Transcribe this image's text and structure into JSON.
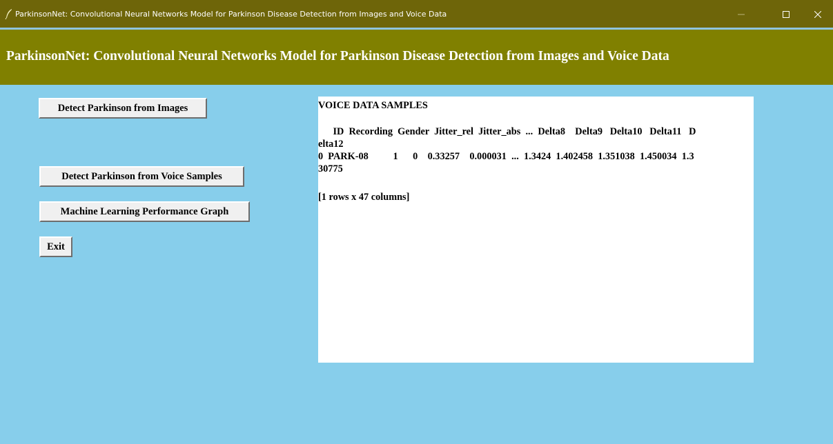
{
  "window": {
    "title": "ParkinsonNet: Convolutional Neural Networks Model for Parkinson Disease Detection from Images and Voice Data",
    "app_icon": "feather-icon",
    "controls": {
      "minimize": "minimize-icon",
      "maximize": "maximize-icon",
      "close": "close-icon"
    }
  },
  "header": {
    "title": "ParkinsonNet: Convolutional Neural Networks Model for Parkinson Disease Detection from Images and Voice Data"
  },
  "buttons": {
    "detect_images": "Detect Parkinson from Images",
    "detect_voice": "Detect Parkinson from Voice Samples",
    "ml_graph": "Machine Learning Performance Graph",
    "exit": "Exit"
  },
  "output": {
    "heading": "VOICE DATA SAMPLES",
    "lines": [
      "      ID  Recording  Gender  Jitter_rel  Jitter_abs  ...  Delta8    Delta9   Delta10   Delta11   D",
      "elta12",
      "0  PARK-08          1      0    0.33257    0.000031  ...  1.3424  1.402458  1.351038  1.450034  1.3",
      "30775",
      "[1 rows x 47 columns]"
    ]
  },
  "colors": {
    "titlebar": "#6e6509",
    "header": "#808000",
    "background": "#87ceeb",
    "panel": "#ffffff"
  }
}
